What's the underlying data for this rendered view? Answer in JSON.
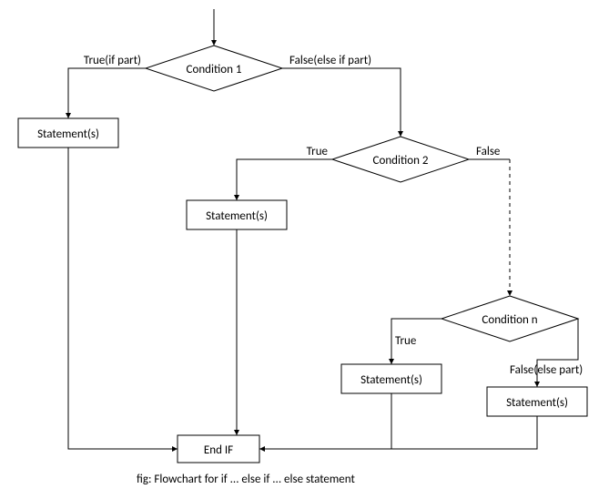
{
  "chart_data": {
    "type": "flowchart",
    "title": "fig: Flowchart for if ... else if ... else statement",
    "nodes": [
      {
        "id": "cond1",
        "kind": "decision",
        "label": "Condition 1"
      },
      {
        "id": "stmt_if",
        "kind": "process",
        "label": "Statement(s)"
      },
      {
        "id": "cond2",
        "kind": "decision",
        "label": "Condition 2"
      },
      {
        "id": "stmt_elif",
        "kind": "process",
        "label": "Statement(s)"
      },
      {
        "id": "condn",
        "kind": "decision",
        "label": "Condition n"
      },
      {
        "id": "stmt_n",
        "kind": "process",
        "label": "Statement(s)"
      },
      {
        "id": "stmt_else",
        "kind": "process",
        "label": "Statement(s)"
      },
      {
        "id": "end",
        "kind": "process",
        "label": "End IF"
      }
    ],
    "edges": [
      {
        "from": "start",
        "to": "cond1",
        "label": ""
      },
      {
        "from": "cond1",
        "to": "stmt_if",
        "label": "True(if part)"
      },
      {
        "from": "cond1",
        "to": "cond2",
        "label": "False(else if part)"
      },
      {
        "from": "cond2",
        "to": "stmt_elif",
        "label": "True"
      },
      {
        "from": "cond2",
        "to": "condn",
        "label": "False",
        "style": "dashed"
      },
      {
        "from": "condn",
        "to": "stmt_n",
        "label": "True"
      },
      {
        "from": "condn",
        "to": "stmt_else",
        "label": "False(else part)"
      },
      {
        "from": "stmt_if",
        "to": "end"
      },
      {
        "from": "stmt_elif",
        "to": "end"
      },
      {
        "from": "stmt_n",
        "to": "end"
      },
      {
        "from": "stmt_else",
        "to": "end"
      }
    ]
  },
  "labels": {
    "cond1": "Condition 1",
    "cond2": "Condition 2",
    "condn": "Condition n",
    "stmt_if": "Statement(s)",
    "stmt_elif": "Statement(s)",
    "stmt_n": "Statement(s)",
    "stmt_else": "Statement(s)",
    "end": "End IF",
    "edge_true_if": "True(if part)",
    "edge_false_elif": "False(else if part)",
    "edge_true2": "True",
    "edge_false2": "False",
    "edge_truen": "True",
    "edge_false_else": "False(else part)",
    "caption": "fig: Flowchart for if ... else if ... else statement"
  }
}
